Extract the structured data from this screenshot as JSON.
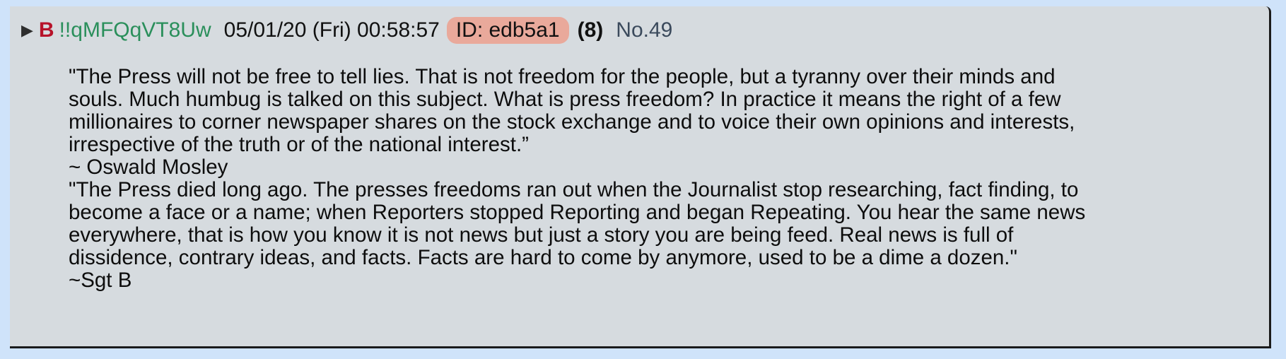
{
  "post": {
    "toggle_icon": "triangle-right-icon",
    "name": "B",
    "tripcode": "!!qMFQqVT8Uw",
    "date": "05/01/20 (Fri) 00:58:57",
    "id_label": "ID: edb5a1",
    "reply_count": "(8)",
    "number": "No.49",
    "colors": {
      "name": "#b7132a",
      "tripcode": "#2a8f5b",
      "id_badge_bg": "#e9a99b",
      "post_bg": "#d6dbdf",
      "page_bg": "#cfe3fa"
    },
    "body_lines": [
      "\"The Press will not be free to tell lies. That is not freedom for the people, but a tyranny over their minds and",
      "souls. Much humbug is talked on this subject. What is press freedom? In practice it means the right of a few",
      "millionaires to corner newspaper shares on the stock exchange and to voice their own opinions and interests,",
      "irrespective of the truth or of the national interest.”",
      "~ Oswald Mosley",
      "\"The Press died long ago. The presses freedoms ran out when the Journalist stop researching, fact finding, to",
      "become a face or a name; when Reporters stopped Reporting and began Repeating. You hear the same news",
      "everywhere, that is how you know it is not news but just a story you are being feed. Real news is full of",
      "dissidence, contrary ideas, and facts. Facts are hard to come by anymore, used to be a dime a dozen.\"",
      "~Sgt B"
    ]
  }
}
